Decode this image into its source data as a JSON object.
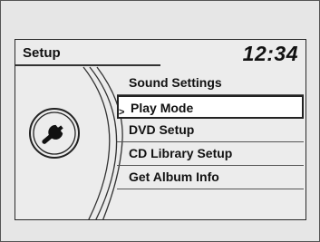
{
  "header": {
    "title": "Setup",
    "clock": "12:34"
  },
  "icon": "wrench-icon",
  "menu": {
    "items": [
      {
        "label": "Sound Settings",
        "selected": false
      },
      {
        "label": "Play Mode",
        "selected": true
      },
      {
        "label": "DVD Setup",
        "selected": false
      },
      {
        "label": "CD Library Setup",
        "selected": false
      },
      {
        "label": "Get Album Info",
        "selected": false
      }
    ],
    "selection_marker": ">"
  }
}
